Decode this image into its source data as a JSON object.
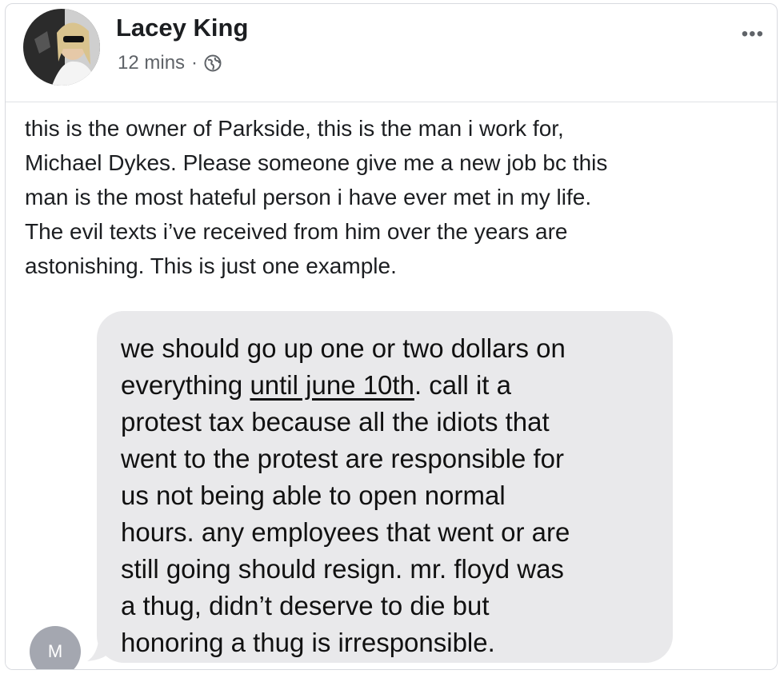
{
  "post": {
    "author": "Lacey King",
    "time": "12 mins",
    "separator": "·",
    "visibility_icon": "globe-icon",
    "menu_icon": "more-dots-icon",
    "menu_label": "•••",
    "text_lines": [
      "this is the owner of Parkside, this is the man i work for,",
      "Michael Dykes. Please someone give me a new job bc this",
      "man is the most hateful person i have ever met in my life.",
      "The evil texts i’ve received from him over the years are",
      "astonishing. This is just one example."
    ]
  },
  "message": {
    "sender_initial": "M",
    "line1": "we should go up one or two dollars on",
    "line2_pre": "everything ",
    "line2_underlined": "until june 10th",
    "line2_post": ". call it a",
    "line3": "protest tax because all the idiots that",
    "line4": "went to the protest are responsible for",
    "line5": "us not being able to open normal",
    "line6": "hours. any employees that went or are",
    "line7": "still going should resign. mr. floyd was",
    "line8": "a thug, didn’t deserve to die but",
    "line9": "honoring a thug is irresponsible."
  },
  "colors": {
    "bubble": "#e9e9eb",
    "sender_avatar": "#a4a7b0",
    "meta_text": "#5f6368"
  }
}
